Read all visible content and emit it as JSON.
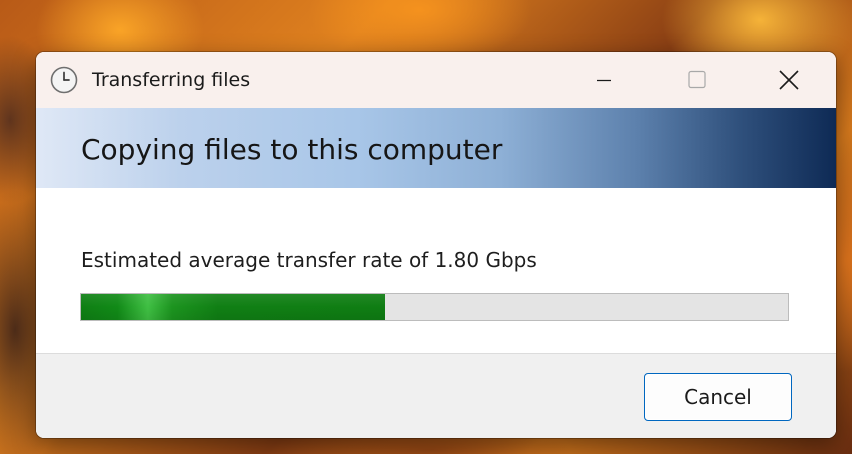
{
  "window": {
    "title": "Transferring files",
    "controls": {
      "minimize_icon": "minimize-icon",
      "maximize_icon": "maximize-icon",
      "close_icon": "close-icon"
    },
    "app_icon": "clock-icon"
  },
  "banner": {
    "heading": "Copying files to this computer"
  },
  "transfer": {
    "rate_text": "Estimated average transfer rate of 1.80 Gbps",
    "progress_fraction": 0.43,
    "progress_color": "#108a17"
  },
  "footer": {
    "cancel_label": "Cancel"
  },
  "colors": {
    "accent_border": "#0067c0",
    "titlebar_bg": "#f9f0ed",
    "banner_dark": "#0e2a55",
    "banner_light": "#dfe8f6"
  }
}
